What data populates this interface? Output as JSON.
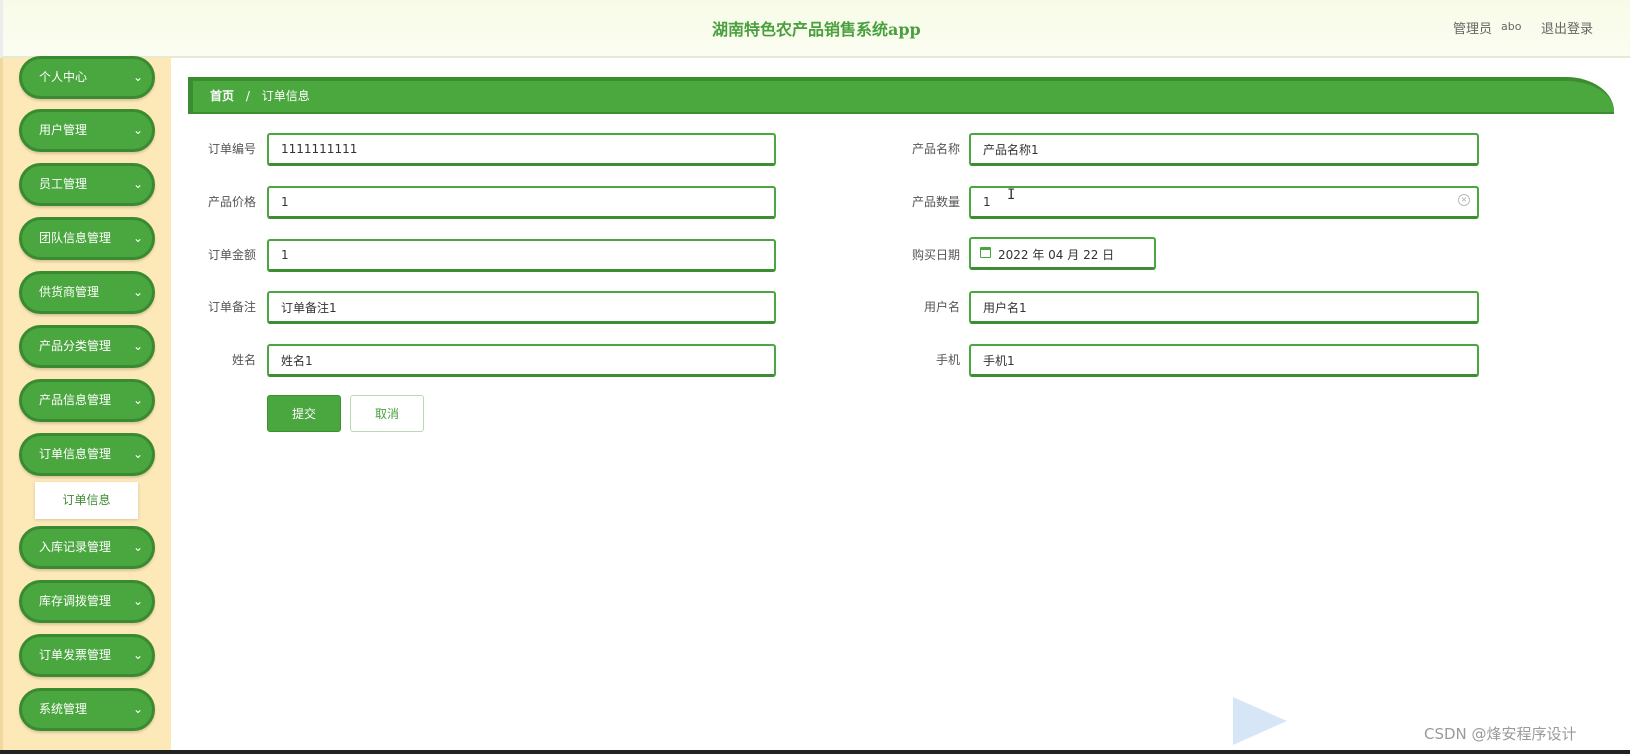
{
  "header": {
    "title": "湖南特色农产品销售系统app",
    "user_role": "管理员",
    "user_name": "abo",
    "logout": "退出登录"
  },
  "sidebar": {
    "items": [
      {
        "label": "个人中心"
      },
      {
        "label": "用户管理"
      },
      {
        "label": "员工管理"
      },
      {
        "label": "团队信息管理"
      },
      {
        "label": "供货商管理"
      },
      {
        "label": "产品分类管理"
      },
      {
        "label": "产品信息管理"
      },
      {
        "label": "订单信息管理"
      },
      {
        "label": "入库记录管理"
      },
      {
        "label": "库存调拨管理"
      },
      {
        "label": "订单发票管理"
      },
      {
        "label": "系统管理"
      }
    ],
    "submenu": {
      "label": "订单信息"
    },
    "chevron": "⌄"
  },
  "breadcrumb": {
    "home": "首页",
    "separator": "/",
    "current": "订单信息"
  },
  "form": {
    "order_no": {
      "label": "订单编号",
      "value": "1111111111"
    },
    "product_name": {
      "label": "产品名称",
      "value": "产品名称1"
    },
    "product_price": {
      "label": "产品价格",
      "value": "1"
    },
    "product_qty": {
      "label": "产品数量",
      "value": "1"
    },
    "order_amount": {
      "label": "订单金额",
      "value": "1"
    },
    "purchase_date": {
      "label": "购买日期",
      "value": "2022 年 04 月 22 日"
    },
    "order_note": {
      "label": "订单备注",
      "value": "订单备注1"
    },
    "username": {
      "label": "用户名",
      "value": "用户名1"
    },
    "name": {
      "label": "姓名",
      "value": "姓名1"
    },
    "phone": {
      "label": "手机",
      "value": "手机1"
    },
    "submit": "提交",
    "cancel": "取消"
  },
  "watermark": "CSDN @烽安程序设计",
  "colors": {
    "primary_green": "#4aa63e",
    "sidebar_bg": "#fde8b8",
    "header_bg": "#f7fbe6"
  }
}
